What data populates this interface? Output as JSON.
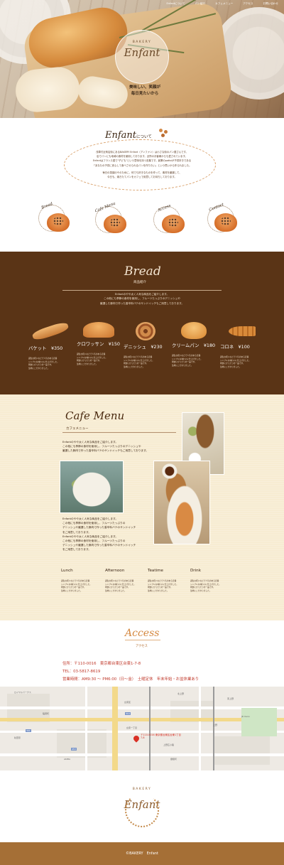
{
  "nav": {
    "items": [
      "Enfantについて",
      "パン紹介",
      "カフェメニュー",
      "アクセス",
      "お問い合わせ"
    ]
  },
  "hero": {
    "logo_small": "BAKERY",
    "logo_big": "Enfant",
    "tagline_line1": "美味しい、笑顔が",
    "tagline_line2": "毎日見たいから"
  },
  "about": {
    "title_main": "Enfant",
    "title_suffix": "について",
    "lines": [
      "浅草付近商店街にあるBAKERY Enfant（アンファン）は小さな街のパン屋さんです。",
      "店でパンにも地域の食材を使用しております。近所のお客様からも愛されています。",
      "Enfantはフランス語で\"子ども\"という意味を持つ言葉です。創業のpatisiが子供好きである",
      "「あなたの子供に安心して食べさせられるパンを作りたい」という思いから作られました。",
      "",
      "毎日の笑顔のそのために、何でも好きなものを作って、素材を厳選して、",
      "今日も、焼きたてパンをカフェで用意してお待ちしております。"
    ],
    "categories": [
      "Bread",
      "Cafe Menu",
      "Access",
      "Contact"
    ]
  },
  "bread": {
    "title": "Bread",
    "subtitle": "商品紹介",
    "intro": [
      "Enfantのやや太く人気な商品をご紹介します。",
      "この他にも季節の食材を使用し、フルーツたっぷりのデニッシュや",
      "厳選した豚肉で作った香辛料バテのサンドイッチもご用意しております。"
    ],
    "items": [
      {
        "name": "バケット　¥350",
        "desc": [
          "誕生お祝いなどで人気のある定番",
          "シンプルな味わいに仕上げました。",
          "朝食にぴったりの一品です。",
          "生地にこだわりました。"
        ]
      },
      {
        "name": "クロワッサン　¥150",
        "desc": [
          "誕生お祝いなどで人気のある定番",
          "シンプルな味わいに仕上げました。",
          "朝食にぴったりの一品です。",
          "生地にこだわりました。"
        ]
      },
      {
        "name": "デニッシュ　¥230",
        "desc": [
          "誕生お祝いなどで人気のある定番",
          "シンプルな味わいに仕上げました。",
          "朝食にぴったりの一品です。",
          "生地にこだわりました。"
        ]
      },
      {
        "name": "クリームパン　¥180",
        "desc": [
          "誕生お祝いなどで人気のある定番",
          "シンプルな味わいに仕上げました。",
          "朝食にぴったりの一品です。",
          "生地にこだわりました。"
        ]
      },
      {
        "name": "コロネ　¥100",
        "desc": [
          "誕生お祝いなどで人気のある定番",
          "シンプルな味わいに仕上げました。",
          "朝食にぴったりの一品です。",
          "生地にこだわりました。"
        ]
      }
    ]
  },
  "cafe": {
    "title": "Cafe Menu",
    "subtitle": "カフェメニュー",
    "text1": [
      "Enfantのやや太く人気な商品をご紹介します。",
      "この他にも季節の食材を使用し、フルーツたっぷりのデニッシュや",
      "厳選した豚肉で作った香辛料バテのサンドイッチもご用意しております。"
    ],
    "text2": [
      "Enfantのやや太く人気な商品をご紹介します。",
      "この他にも季節の食材を使用し、フルーツたっぷりの",
      "デニッシュや厳選した豚肉で作った香辛料バテのサンドイッチ",
      "をご用意しております。",
      "Enfantのやや太く人気な商品をご紹介します。",
      "この他にも季節の食材を使用し、フルーツたっぷりの",
      "デニッシュや厳選した豚肉で作った香辛料バテのサンドイッチ",
      "をご用意しております。"
    ],
    "menus": [
      {
        "name": "Lunch",
        "desc": [
          "誕生お祝いなどで人気のある定番",
          "シンプルな味わいに仕上げました。",
          "朝食にぴったりの一品です。",
          "生地にこだわりました。"
        ]
      },
      {
        "name": "Afternoon",
        "desc": [
          "誕生お祝いなどで人気のある定番",
          "シンプルな味わいに仕上げました。",
          "朝食にぴったりの一品です。",
          "生地にこだわりました。"
        ]
      },
      {
        "name": "Teatime",
        "desc": [
          "誕生お祝いなどで人気のある定番",
          "シンプルな味わいに仕上げました。",
          "朝食にぴったりの一品です。",
          "生地にこだわりました。"
        ]
      },
      {
        "name": "Drink",
        "desc": [
          "誕生お祝いなどで人気のある定番",
          "シンプルな味わいに仕上げました。",
          "朝食にぴったりの一品です。",
          "生地にこだわりました。"
        ]
      }
    ]
  },
  "access": {
    "title": "Access",
    "subtitle": "アクセス",
    "address": "住所：〒110-0016　東京都台東区台東1-7-8",
    "tel": "TEL：03-5817-8619",
    "hours": "営業時間：AM9:30 ～ PM6:00（日～金）　土曜定休　年末年始・お盆休業あり"
  },
  "map": {
    "labels": [
      "ロイヤルパークス",
      "台東区",
      "東上野",
      "上野",
      "秋葉原",
      "御徒町",
      "台東一丁目",
      "JR Ueno",
      "上野広小路",
      "AKIBA",
      "稲荷町",
      "北上野"
    ],
    "badges": [
      "319",
      "453",
      "301"
    ],
    "pin_label": "〒110-0016 東京都台東区台東1丁目7-8"
  },
  "footer": {
    "logo_small": "BAKERY",
    "logo_big": "Enfant",
    "copyright": "©BAKERY　Enfant"
  },
  "colors": {
    "brown": "#5a3416",
    "accent": "#d4873e",
    "cream": "#f7ecd2",
    "footer": "#a56f36"
  }
}
